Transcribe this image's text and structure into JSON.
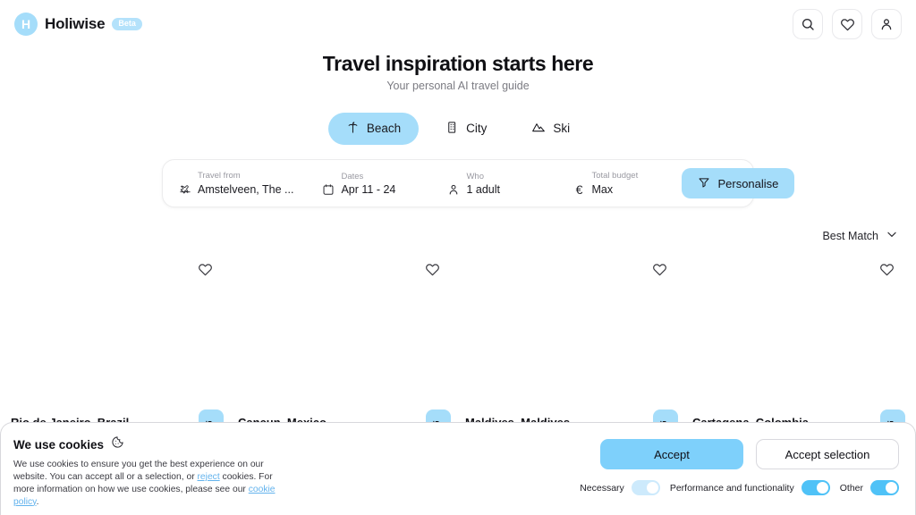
{
  "header": {
    "logo_letter": "H",
    "brand_name": "Holiwise",
    "beta_label": "Beta",
    "actions": [
      {
        "name": "search-icon",
        "label": "Search"
      },
      {
        "name": "heart-icon",
        "label": "Favorites"
      },
      {
        "name": "user-icon",
        "label": "Account"
      }
    ]
  },
  "hero": {
    "title": "Travel inspiration starts here",
    "subtitle": "Your personal AI travel guide"
  },
  "tabs": [
    {
      "label": "Beach",
      "icon": "palm-tree-icon",
      "active": true
    },
    {
      "label": "City",
      "icon": "building-icon",
      "active": false
    },
    {
      "label": "Ski",
      "icon": "mountain-icon",
      "active": false
    }
  ],
  "searchbar": {
    "travel_from": {
      "label": "Travel from",
      "value": "Amstelveen, The ...",
      "icon": "plane-departure-icon"
    },
    "dates": {
      "label": "Dates",
      "value": "Apr 11 - 24",
      "icon": "calendar-icon"
    },
    "who": {
      "label": "Who",
      "value": "1 adult",
      "icon": "person-icon"
    },
    "budget": {
      "label": "Total budget",
      "value": "Max",
      "icon": "euro-icon",
      "symbol": "€"
    },
    "personalise_label": "Personalise"
  },
  "sort": {
    "label": "Best Match",
    "icon": "chevron-down-icon"
  },
  "cards": [
    {
      "title": "Rio de Janeiro, Brazil",
      "badge_icon": "bed-icon",
      "heart_icon": "heart-icon"
    },
    {
      "title": "Cancun, Mexico",
      "badge_icon": "bed-icon",
      "heart_icon": "heart-icon"
    },
    {
      "title": "Maldives, Maldives",
      "badge_icon": "bed-icon",
      "heart_icon": "heart-icon"
    },
    {
      "title": "Cartagena, Colombia",
      "badge_icon": "bed-icon",
      "heart_icon": "heart-icon"
    }
  ],
  "cookie": {
    "title": "We use cookies",
    "icon": "cookie-icon",
    "body_part1": "We use cookies to ensure you get the best experience on our website. You can accept all or a selection, or ",
    "reject_link": "reject",
    "body_part2": " cookies. For more information on how we use cookies, please see our ",
    "policy_link": "cookie policy",
    "body_end": ".",
    "accept_label": "Accept",
    "accept_selection_label": "Accept selection",
    "toggles": [
      {
        "label": "Necessary",
        "on": true,
        "disabled": true
      },
      {
        "label": "Performance and functionality",
        "on": true,
        "disabled": false
      },
      {
        "label": "Other",
        "on": true,
        "disabled": false
      }
    ]
  },
  "colors": {
    "accent": "#a5ddfa",
    "accent_strong": "#7ed0fb",
    "link": "#63b3ed",
    "toggle_on": "#4fc2f7",
    "toggle_pale": "#cdeafc"
  }
}
